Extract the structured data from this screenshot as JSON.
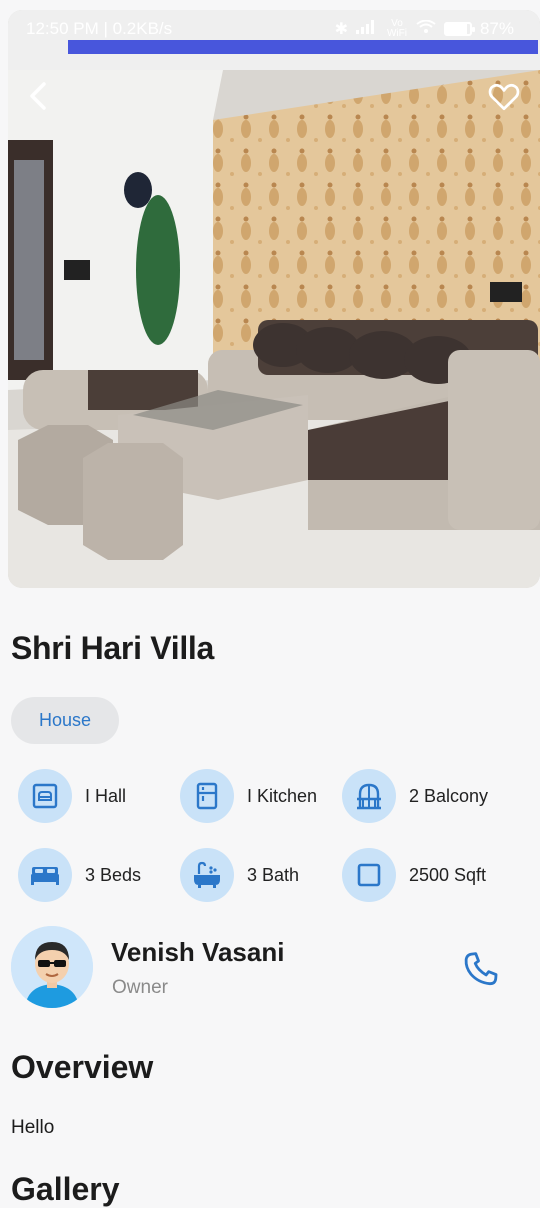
{
  "status_bar": {
    "time_speed": "12:50 PM | 0.2KB/s",
    "network": "Vo WiFi",
    "battery": "87%",
    "battery_level": 0.87
  },
  "hero": {
    "image": "living-room-photo",
    "back_icon": "chevron-left-icon",
    "favorite_icon": "heart-outline-icon"
  },
  "property": {
    "title": "Shri Hari Villa",
    "type_chip": "House",
    "features": [
      {
        "icon": "sofa-frame-icon",
        "label": "I Hall"
      },
      {
        "icon": "kitchen-icon",
        "label": "I Kitchen"
      },
      {
        "icon": "balcony-icon",
        "label": "2 Balcony"
      },
      {
        "icon": "bed-icon",
        "label": "3 Beds"
      },
      {
        "icon": "bathtub-icon",
        "label": "3 Bath"
      },
      {
        "icon": "area-square-icon",
        "label": "2500 Sqft"
      }
    ]
  },
  "owner": {
    "name": "Venish Vasani",
    "role": "Owner",
    "call_icon": "phone-icon"
  },
  "sections": {
    "overview_title": "Overview",
    "overview_text": "Hello",
    "gallery_title": "Gallery"
  },
  "colors": {
    "accent": "#2b77c9",
    "icon_circle": "#c9e2f8",
    "chip_bg": "#e5e6e8",
    "background": "#f7f7f8"
  }
}
